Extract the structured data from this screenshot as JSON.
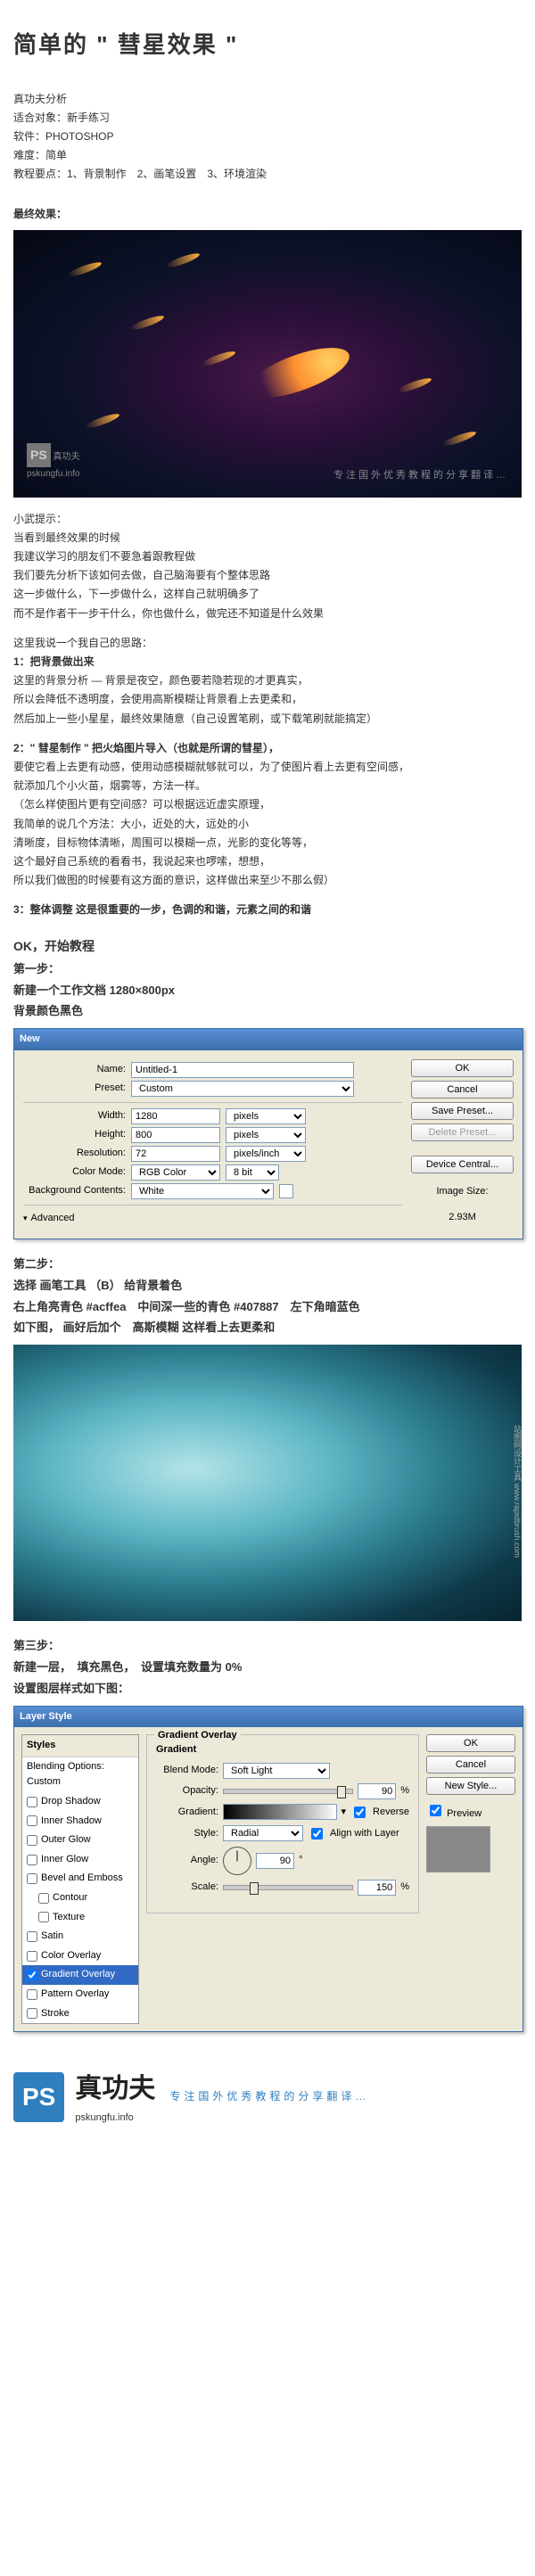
{
  "title": "简单的 \" 彗星效果 \"",
  "meta": {
    "l0": "真功夫分析",
    "l1": "适合对象：新手练习",
    "l2": "软件：PHOTOSHOP",
    "l3": "难度：简单",
    "l4": "教程要点：1、背景制作　2、画笔设置　3、环境渲染"
  },
  "efx_label": "最终效果：",
  "efx_wm_brand": "真功夫",
  "efx_wm_url": "pskungfu.info",
  "efx_caption": "专注国外优秀教程的分享翻译…",
  "para": {
    "p0": "小武提示：",
    "p1": "当看到最终效果的时候",
    "p2": "我建议学习的朋友们不要急着跟教程做",
    "p3": "我们要先分析下该如何去做，自己脑海要有个整体思路",
    "p4": "这一步做什么，下一步做什么，这样自己就明确多了",
    "p5": "而不是作者干一步干什么，你也做什么，做完还不知道是什么效果",
    "p6": "这里我说一个我自己的思路：",
    "p7": "1：把背景做出来",
    "p8": "这里的背景分析 — 背景是夜空，颜色要若隐若现的才更真实，",
    "p9": "所以会降低不透明度，会使用高斯模糊让背景看上去更柔和，",
    "p10": "然后加上一些小星星，最终效果随意（自己设置笔刷，或下载笔刷就能搞定）",
    "p11": "2：\" 彗星制作 \" 把火焰图片导入（也就是所谓的彗星），",
    "p12": "要使它看上去更有动感，使用动感模糊就够就可以，为了使图片看上去更有空间感，",
    "p13": "就添加几个小火苗，烟雾等，方法一样。",
    "p14": "（怎么样使图片更有空间感？可以根据远近虚实原理，",
    "p15": "我简单的说几个方法：大小，近处的大，远处的小",
    "p16": "清晰度，目标物体清晰，周围可以模糊一点，光影的变化等等，",
    "p17": "这个最好自己系统的看看书，我说起来也啰嗦，想想，",
    "p18": "所以我们做图的时候要有这方面的意识，这样做出来至少不那么假）",
    "p19": "3：整体调整 这是很重要的一步，色调的和谐，元素之间的和谐"
  },
  "step1": {
    "ok": "OK，开始教程",
    "h": "第一步：",
    "l1": "新建一个工作文档 1280×800px",
    "l2": "背景颜色黑色"
  },
  "newDialog": {
    "title": "New",
    "nameLabel": "Name:",
    "nameValue": "Untitled-1",
    "presetLabel": "Preset:",
    "presetValue": "Custom",
    "widthLabel": "Width:",
    "widthValue": "1280",
    "widthUnit": "pixels",
    "heightLabel": "Height:",
    "heightValue": "800",
    "heightUnit": "pixels",
    "resLabel": "Resolution:",
    "resValue": "72",
    "resUnit": "pixels/inch",
    "cmLabel": "Color Mode:",
    "cmValue": "RGB Color",
    "cmBits": "8 bit",
    "bgLabel": "Background Contents:",
    "bgValue": "White",
    "advanced": "Advanced",
    "ok": "OK",
    "cancel": "Cancel",
    "savePreset": "Save Preset...",
    "deletePreset": "Delete Preset...",
    "deviceCentral": "Device Central...",
    "imgSizeLabel": "Image Size:",
    "imgSize": "2.93M"
  },
  "step2": {
    "h": "第二步：",
    "l1": "选择 画笔工具 （B） 给背景着色",
    "l2": "右上角亮青色 #acffea　中间深一些的青色 #407887　左下角暗蓝色",
    "l3": "如下图， 画好后加个　高斯模糊 这样看上去更柔和"
  },
  "colors": {
    "hilite": "#acffea",
    "mid": "#407887"
  },
  "step3": {
    "h": "第三步：",
    "l1": "新建一层，　填充黑色，　设置填充数量为 0%",
    "l2": "设置图层样式如下图："
  },
  "layerStyle": {
    "title": "Layer Style",
    "stylesHeader": "Styles",
    "items": [
      {
        "label": "Blending Options: Custom",
        "checked": false,
        "plain": true
      },
      {
        "label": "Drop Shadow",
        "checked": false
      },
      {
        "label": "Inner Shadow",
        "checked": false
      },
      {
        "label": "Outer Glow",
        "checked": false
      },
      {
        "label": "Inner Glow",
        "checked": false
      },
      {
        "label": "Bevel and Emboss",
        "checked": false
      },
      {
        "label": "Contour",
        "checked": false,
        "indent": true
      },
      {
        "label": "Texture",
        "checked": false,
        "indent": true
      },
      {
        "label": "Satin",
        "checked": false
      },
      {
        "label": "Color Overlay",
        "checked": false
      },
      {
        "label": "Gradient Overlay",
        "checked": true,
        "selected": true
      },
      {
        "label": "Pattern Overlay",
        "checked": false
      },
      {
        "label": "Stroke",
        "checked": false
      }
    ],
    "panelTitle": "Gradient Overlay",
    "subTitle": "Gradient",
    "blendModeLabel": "Blend Mode:",
    "blendMode": "Soft Light",
    "opacityLabel": "Opacity:",
    "opacity": "90",
    "pct": "%",
    "gradientLabel": "Gradient:",
    "reverse": "Reverse",
    "styleLabel": "Style:",
    "style": "Radial",
    "alignLayer": "Align with Layer",
    "angleLabel": "Angle:",
    "angle": "90",
    "deg": "°",
    "scaleLabel": "Scale:",
    "scale": "150",
    "ok": "OK",
    "cancel": "Cancel",
    "newStyle": "New Style...",
    "preview": "Preview"
  },
  "footer": {
    "ps": "PS",
    "brand": "真功夫",
    "url": "pskungfu.info",
    "tag": "专注国外优秀教程的分享翻译…"
  }
}
